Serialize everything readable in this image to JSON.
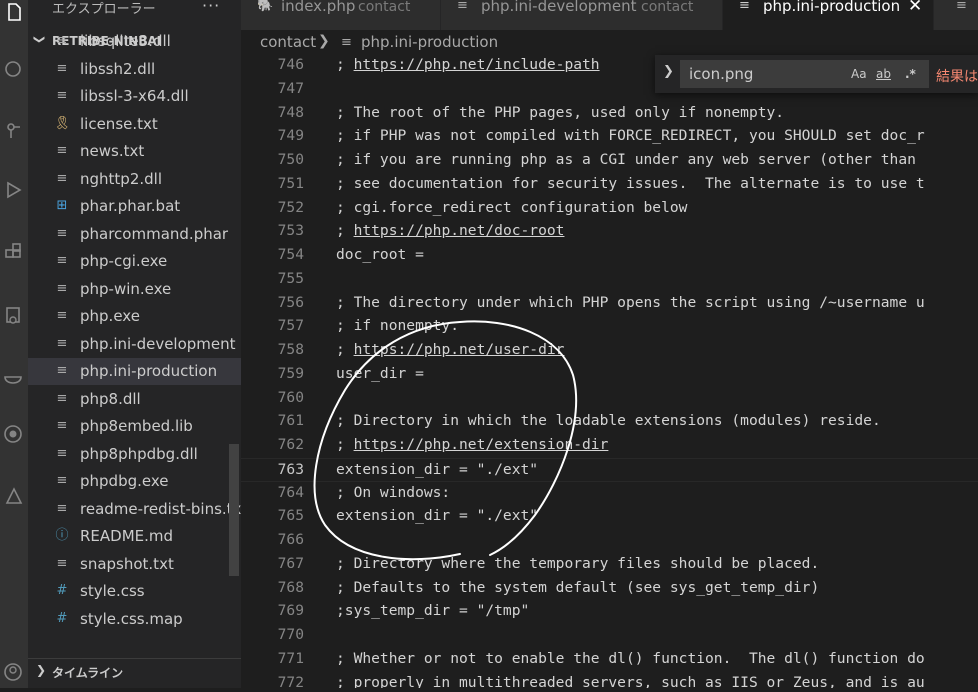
{
  "explorer": {
    "title": "エクスプローラー",
    "more": "···",
    "folder_chevron": "❯",
    "folder_name": "RETRIBE-NINBAI",
    "files": [
      {
        "name": "libsqlite3.dll",
        "icon": "file-icon"
      },
      {
        "name": "libssh2.dll",
        "icon": "file-icon"
      },
      {
        "name": "libssl-3-x64.dll",
        "icon": "file-icon"
      },
      {
        "name": "license.txt",
        "icon": "license-icon"
      },
      {
        "name": "news.txt",
        "icon": "file-icon"
      },
      {
        "name": "nghttp2.dll",
        "icon": "file-icon"
      },
      {
        "name": "phar.phar.bat",
        "icon": "windows-icon"
      },
      {
        "name": "pharcommand.phar",
        "icon": "file-icon"
      },
      {
        "name": "php-cgi.exe",
        "icon": "file-icon"
      },
      {
        "name": "php-win.exe",
        "icon": "file-icon"
      },
      {
        "name": "php.exe",
        "icon": "file-icon"
      },
      {
        "name": "php.ini-development",
        "icon": "file-icon"
      },
      {
        "name": "php.ini-production",
        "icon": "file-icon"
      },
      {
        "name": "php8.dll",
        "icon": "file-icon"
      },
      {
        "name": "php8embed.lib",
        "icon": "file-icon"
      },
      {
        "name": "php8phpdbg.dll",
        "icon": "file-icon"
      },
      {
        "name": "phpdbg.exe",
        "icon": "file-icon"
      },
      {
        "name": "readme-redist-bins.txt",
        "icon": "file-icon"
      },
      {
        "name": "README.md",
        "icon": "info-icon"
      },
      {
        "name": "snapshot.txt",
        "icon": "file-icon"
      },
      {
        "name": "style.css",
        "icon": "css-hash-icon"
      },
      {
        "name": "style.css.map",
        "icon": "css-hash-icon"
      }
    ],
    "selected_file": "php.ini-production",
    "timeline_label": "タイムライン",
    "timeline_chevron": "❯"
  },
  "tabs": [
    {
      "name": "index.php",
      "desc": "contact",
      "icon": "php-elephant-icon",
      "active": false
    },
    {
      "name": "php.ini-development",
      "desc": "contact",
      "icon": "lines-icon",
      "active": false
    },
    {
      "name": "php.ini-production",
      "desc": "",
      "icon": "lines-icon",
      "active": true
    }
  ],
  "tab_close": "✕",
  "breadcrumb": {
    "folder": "contact",
    "separator": "❯",
    "file": "php.ini-production"
  },
  "find": {
    "toggle": "❯",
    "query": "icon.png",
    "match_case": "Aa",
    "whole_word": "ab",
    "regex": ".*",
    "result": "結果は"
  },
  "editor": {
    "current_line": 763,
    "lines": [
      {
        "n": "746",
        "text": "; https://php.net/include-path",
        "url": "https://php.net/include-path"
      },
      {
        "n": "747",
        "text": ""
      },
      {
        "n": "748",
        "text": "; The root of the PHP pages, used only if nonempty."
      },
      {
        "n": "749",
        "text": "; if PHP was not compiled with FORCE_REDIRECT, you SHOULD set doc_r"
      },
      {
        "n": "750",
        "text": "; if you are running php as a CGI under any web server (other than"
      },
      {
        "n": "751",
        "text": "; see documentation for security issues.  The alternate is to use t"
      },
      {
        "n": "752",
        "text": "; cgi.force_redirect configuration below"
      },
      {
        "n": "753",
        "text": "; https://php.net/doc-root",
        "url": "https://php.net/doc-root"
      },
      {
        "n": "754",
        "text": "doc_root ="
      },
      {
        "n": "755",
        "text": ""
      },
      {
        "n": "756",
        "text": "; The directory under which PHP opens the script using /~username u"
      },
      {
        "n": "757",
        "text": "; if nonempty."
      },
      {
        "n": "758",
        "text": "; https://php.net/user-dir",
        "url": "https://php.net/user-dir"
      },
      {
        "n": "759",
        "text": "user_dir ="
      },
      {
        "n": "760",
        "text": ""
      },
      {
        "n": "761",
        "text": "; Directory in which the loadable extensions (modules) reside."
      },
      {
        "n": "762",
        "text": "; https://php.net/extension-dir",
        "url": "https://php.net/extension-dir"
      },
      {
        "n": "763",
        "text": "extension_dir = \"./ext\""
      },
      {
        "n": "764",
        "text": "; On windows:"
      },
      {
        "n": "765",
        "text": "extension_dir = \"./ext\""
      },
      {
        "n": "766",
        "text": ""
      },
      {
        "n": "767",
        "text": "; Directory where the temporary files should be placed."
      },
      {
        "n": "768",
        "text": "; Defaults to the system default (see sys_get_temp_dir)"
      },
      {
        "n": "769",
        "text": ";sys_temp_dir = \"/tmp\""
      },
      {
        "n": "770",
        "text": ""
      },
      {
        "n": "771",
        "text": "; Whether or not to enable the dl() function.  The dl() function do"
      },
      {
        "n": "772",
        "text": "; properly in multithreaded servers, such as IIS or Zeus, and is au"
      }
    ]
  },
  "colors": {
    "editor_bg": "#1e1e1e",
    "sidebar_bg": "#252526",
    "activity_bg": "#333333",
    "find_result": "#f48771",
    "annotation": "#ffffff"
  }
}
